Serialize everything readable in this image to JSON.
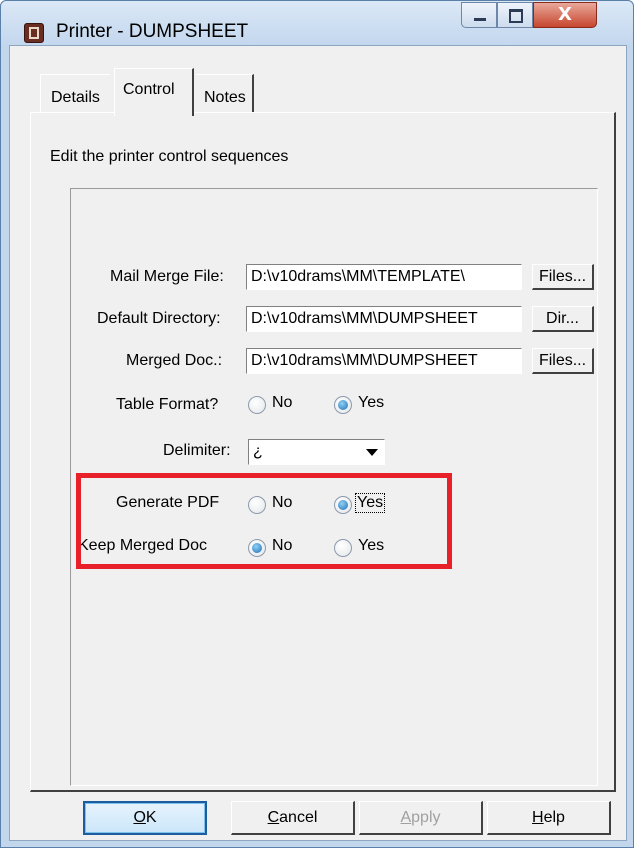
{
  "window": {
    "title": "Printer - DUMPSHEET",
    "close_glyph": "X",
    "icons": {
      "app": "printer-app-icon",
      "minimize": "minimize-icon",
      "maximize": "maximize-icon",
      "close": "close-icon"
    }
  },
  "tabs": [
    {
      "label": "Details",
      "active": false
    },
    {
      "label": "Control",
      "active": true
    },
    {
      "label": "Notes",
      "active": false
    }
  ],
  "control_tab": {
    "instruction": "Edit the printer control sequences",
    "mail_merge_file": {
      "label": "Mail Merge File:",
      "value": "D:\\v10drams\\MM\\TEMPLATE\\",
      "button": "Files..."
    },
    "default_directory": {
      "label": "Default Directory:",
      "value": "D:\\v10drams\\MM\\DUMPSHEET",
      "button": "Dir..."
    },
    "merged_doc": {
      "label": "Merged Doc.:",
      "value": "D:\\v10drams\\MM\\DUMPSHEET",
      "button": "Files..."
    },
    "table_format": {
      "label": "Table Format?",
      "option_no": "No",
      "option_yes": "Yes",
      "selected": "Yes"
    },
    "delimiter": {
      "label": "Delimiter:",
      "selected_value": "¿"
    },
    "generate_pdf": {
      "label": "Generate PDF",
      "option_no": "No",
      "option_yes": "Yes",
      "selected": "Yes"
    },
    "keep_merged_doc": {
      "label": "Keep Merged Doc",
      "option_no": "No",
      "option_yes": "Yes",
      "selected": "No"
    }
  },
  "buttons": {
    "ok": {
      "accel": "O",
      "rest": "K"
    },
    "cancel": {
      "accel": "C",
      "rest": "ancel"
    },
    "apply": {
      "accel": "A",
      "rest": "pply",
      "disabled": true
    },
    "help": {
      "accel": "H",
      "rest": "elp"
    }
  },
  "colors": {
    "highlight_border": "#e8202a",
    "dialog_background": "#f0f0f0",
    "title_bar": "#c3d7ee",
    "close_button": "#c6462e",
    "radio_selected": "#1f6fb5"
  }
}
